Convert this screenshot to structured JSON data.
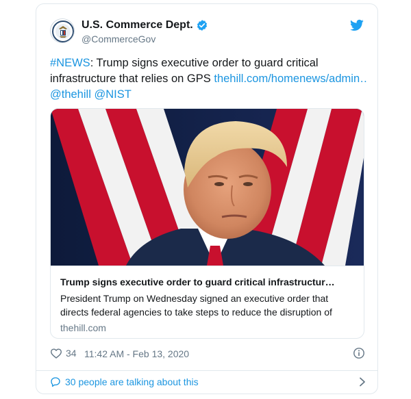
{
  "author": {
    "display_name": "U.S. Commerce Dept.",
    "handle": "@CommerceGov",
    "verified": true
  },
  "tweet": {
    "hashtag": "#NEWS",
    "text_line1_rest": ": Trump signs executive order to guard critical",
    "text_line2_start": "infrastructure that relies on GPS ",
    "url_text": "thehill.com/homenews/admin…",
    "mention1": "@thehill",
    "mention2": "@NIST"
  },
  "card": {
    "title": "Trump signs executive order to guard critical infrastructur…",
    "description_line1": "President Trump on Wednesday signed an executive order that",
    "description_line2": "directs federal agencies to take steps to reduce the disruption of",
    "domain": "thehill.com"
  },
  "meta": {
    "like_count": "34",
    "timestamp": "11:42 AM - Feb 13, 2020"
  },
  "footer": {
    "conversation_text": "30 people are talking about this"
  },
  "colors": {
    "link": "#1b95e0",
    "secondary_text": "#657786",
    "border": "#e1e8ed",
    "twitter_blue": "#1da1f2"
  },
  "icons": [
    "commerce-seal-avatar",
    "verified-badge-icon",
    "twitter-bird-icon",
    "heart-icon",
    "info-icon",
    "speech-bubble-icon",
    "chevron-right-icon"
  ]
}
